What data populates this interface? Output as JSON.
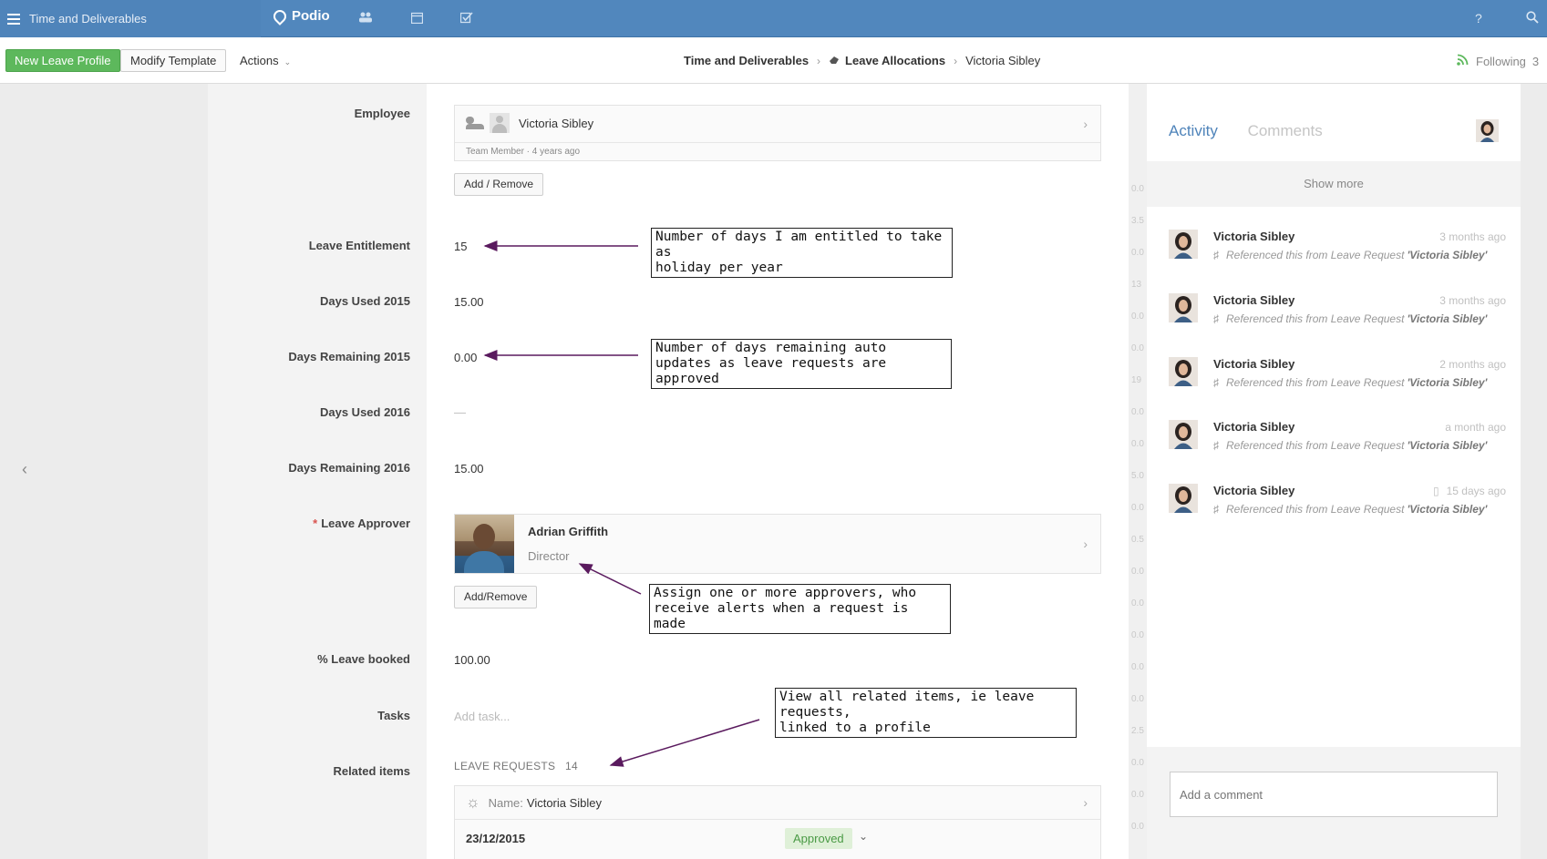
{
  "workspace": {
    "title": "Time and Deliverables"
  },
  "brand": {
    "name": "Podio"
  },
  "topnav": {
    "help": "?",
    "search": "search-icon"
  },
  "toolbar": {
    "new_item": "New Leave Profile",
    "modify_template": "Modify Template",
    "actions": "Actions"
  },
  "breadcrumb": {
    "workspace": "Time and Deliverables",
    "app": "Leave Allocations",
    "item": "Victoria Sibley"
  },
  "following": {
    "label": "Following",
    "count": "3"
  },
  "fields": {
    "employee": {
      "label": "Employee",
      "name": "Victoria Sibley",
      "meta": "Team Member · 4 years ago",
      "button": "Add / Remove"
    },
    "leave_entitlement": {
      "label": "Leave Entitlement",
      "value": "15"
    },
    "days_used_2015": {
      "label": "Days Used 2015",
      "value": "15.00"
    },
    "days_remaining_2015": {
      "label": "Days Remaining 2015",
      "value": "0.00"
    },
    "days_used_2016": {
      "label": "Days Used 2016",
      "value": "—"
    },
    "days_remaining_2016": {
      "label": "Days Remaining 2016",
      "value": "15.00"
    },
    "leave_approver": {
      "label": "Leave Approver",
      "required_mark": "*",
      "name": "Adrian Griffith",
      "role": "Director",
      "button": "Add/Remove"
    },
    "leave_booked": {
      "label": "% Leave booked",
      "value": "100.00"
    },
    "tasks": {
      "label": "Tasks",
      "placeholder": "Add task..."
    },
    "related": {
      "label": "Related items",
      "group": "LEAVE REQUESTS",
      "count": "14",
      "name_label": "Name:",
      "name_value": "Victoria Sibley",
      "date": "23/12/2015",
      "status": "Approved"
    }
  },
  "annotations": [
    {
      "text": "Number of days I am entitled to take as\nholiday per year"
    },
    {
      "text": "Number of days remaining auto\nupdates as leave requests are approved"
    },
    {
      "text": "Assign one or more approvers, who\nreceive alerts when a request is made"
    },
    {
      "text": "View all related items, ie leave requests,\nlinked to a profile"
    }
  ],
  "strip_values": [
    "0.0",
    "3.5",
    "0.0",
    "13",
    "0.0",
    "0.0",
    "19",
    "0.0",
    "0.0",
    "5.0",
    "0.0",
    "0.5",
    "0.0",
    "0.0",
    "0.0",
    "0.0",
    "0.0",
    "2.5",
    "0.0",
    "0.0",
    "0.0"
  ],
  "activity": {
    "tab_activity": "Activity",
    "tab_comments": "Comments",
    "show_more": "Show more",
    "items": [
      {
        "who": "Victoria Sibley",
        "when": "3 months ago",
        "what": "Referenced this from Leave Request",
        "target": "'Victoria Sibley'"
      },
      {
        "who": "Victoria Sibley",
        "when": "3 months ago",
        "what": "Referenced this from Leave Request",
        "target": "'Victoria Sibley'"
      },
      {
        "who": "Victoria Sibley",
        "when": "2 months ago",
        "what": "Referenced this from Leave Request",
        "target": "'Victoria Sibley'"
      },
      {
        "who": "Victoria Sibley",
        "when": "a month ago",
        "what": "Referenced this from Leave Request",
        "target": "'Victoria Sibley'"
      },
      {
        "who": "Victoria Sibley",
        "when": "15 days ago",
        "what": "Referenced this from Leave Request",
        "target": "'Victoria Sibley'"
      }
    ],
    "comment_placeholder": "Add a comment"
  },
  "colors": {
    "topbar": "#5187bd",
    "accent": "#4f84ba",
    "primary_button": "#5db85c",
    "annotation_arrow": "#5a1a5e"
  }
}
